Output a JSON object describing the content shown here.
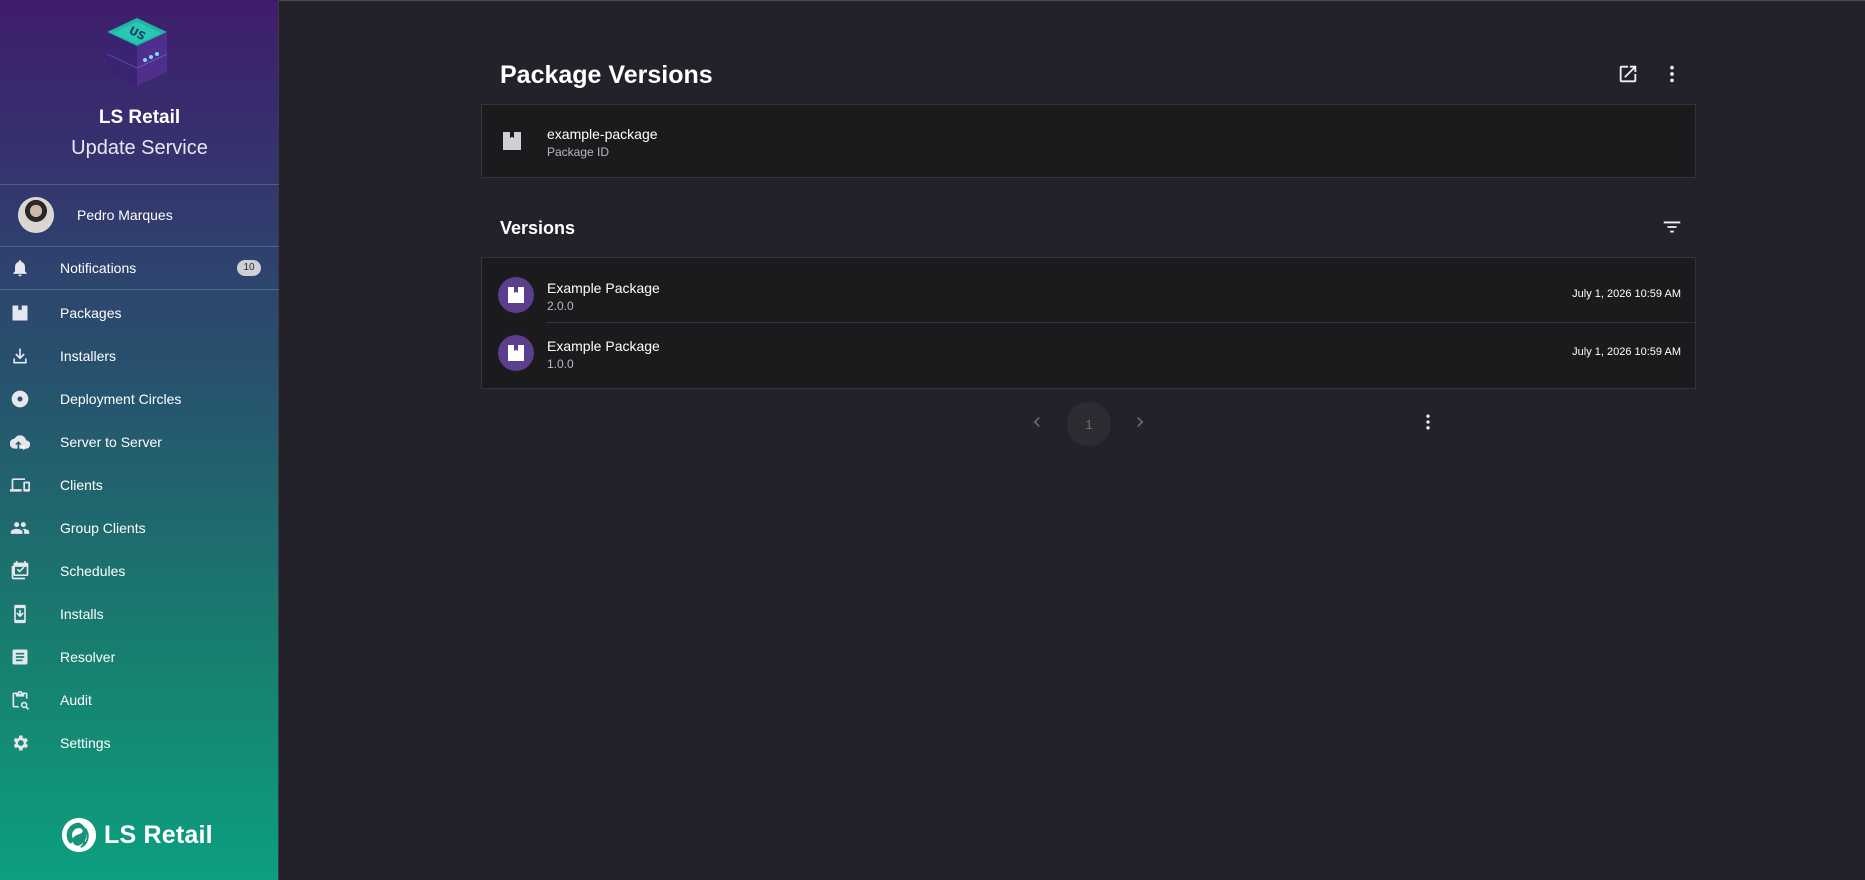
{
  "brand": {
    "logo_text": "US",
    "title": "LS Retail",
    "subtitle": "Update Service"
  },
  "user": {
    "name": "Pedro Marques"
  },
  "nav": {
    "items": [
      {
        "label": "Notifications",
        "icon": "bell-icon",
        "badge": "10"
      },
      {
        "label": "Packages",
        "icon": "package-icon"
      },
      {
        "label": "Installers",
        "icon": "download-icon"
      },
      {
        "label": "Deployment Circles",
        "icon": "disc-icon"
      },
      {
        "label": "Server to Server",
        "icon": "cloud-upload-icon"
      },
      {
        "label": "Clients",
        "icon": "devices-icon"
      },
      {
        "label": "Group Clients",
        "icon": "group-icon"
      },
      {
        "label": "Schedules",
        "icon": "calendar-check-icon"
      },
      {
        "label": "Installs",
        "icon": "install-icon"
      },
      {
        "label": "Resolver",
        "icon": "document-icon"
      },
      {
        "label": "Audit",
        "icon": "clipboard-search-icon"
      },
      {
        "label": "Settings",
        "icon": "gear-icon"
      }
    ]
  },
  "footer": {
    "logo_text": "LS Retail"
  },
  "main": {
    "title": "Package Versions",
    "package": {
      "id": "example-package",
      "id_label": "Package ID"
    },
    "versions": {
      "title": "Versions",
      "rows": [
        {
          "name": "Example Package",
          "version": "2.0.0",
          "date": "July 1, 2026 10:59 AM"
        },
        {
          "name": "Example Package",
          "version": "1.0.0",
          "date": "July 1, 2026 10:59 AM"
        }
      ]
    },
    "pagination": {
      "current_page": "1"
    }
  },
  "colors": {
    "background": "#23222a",
    "card": "#1b1b1e",
    "accent_purple": "#5b3e8c",
    "sidebar_top": "#3f1d6d",
    "sidebar_bottom": "#0c9f80"
  }
}
